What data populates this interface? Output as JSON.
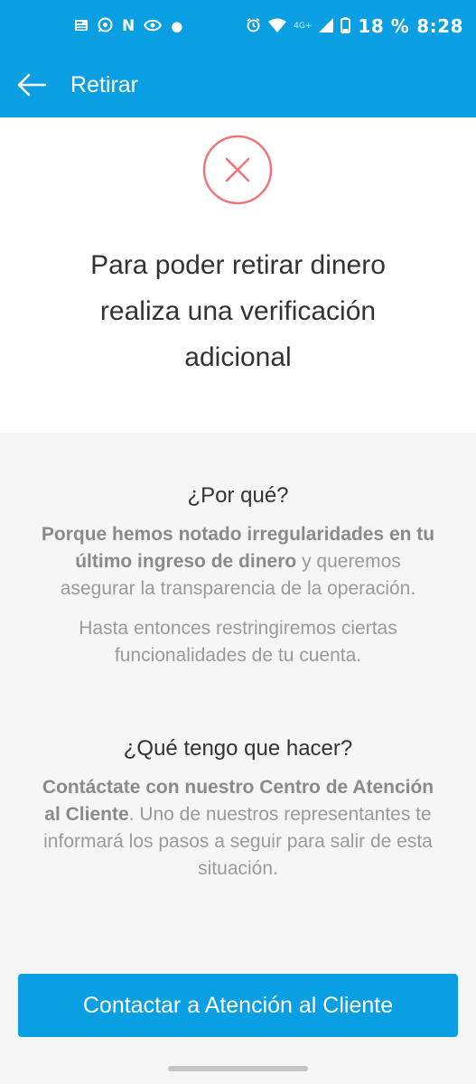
{
  "status_bar": {
    "battery_percent": "18 %",
    "time": "8:28",
    "network": "4G+",
    "left_icons": [
      "news-icon",
      "whatsapp-icon",
      "n-app-icon",
      "bank-app-icon",
      "dot-icon"
    ],
    "right_icons": [
      "alarm-icon",
      "wifi-icon",
      "signal-icon",
      "battery-icon"
    ]
  },
  "app_bar": {
    "title": "Retirar",
    "back_icon": "arrow-left-icon"
  },
  "error_icon": {
    "name": "error-x-icon",
    "color": "#f0757a"
  },
  "headline": {
    "lines": [
      "Para poder retirar dinero",
      "realiza una verificación",
      "adicional"
    ]
  },
  "why": {
    "title": "¿Por qué?",
    "bold": "Porque hemos notado irregularidades en tu último ingreso de dinero",
    "normal": " y queremos asegurar la transparencia de la operación.",
    "restriction": "Hasta entonces restringiremos ciertas funcionalidades de tu cuenta."
  },
  "what_to_do": {
    "title": "¿Qué tengo que hacer?",
    "bold": "Contáctate con nuestro Centro de Atención al Cliente",
    "normal": ". Uno de nuestros representantes te informará los pasos a seguir para salir de esta situación."
  },
  "cta": {
    "label": "Contactar a Atención al Cliente"
  },
  "colors": {
    "accent": "#0a9fe3",
    "error": "#f0757a",
    "background": "#f6f6f6"
  }
}
